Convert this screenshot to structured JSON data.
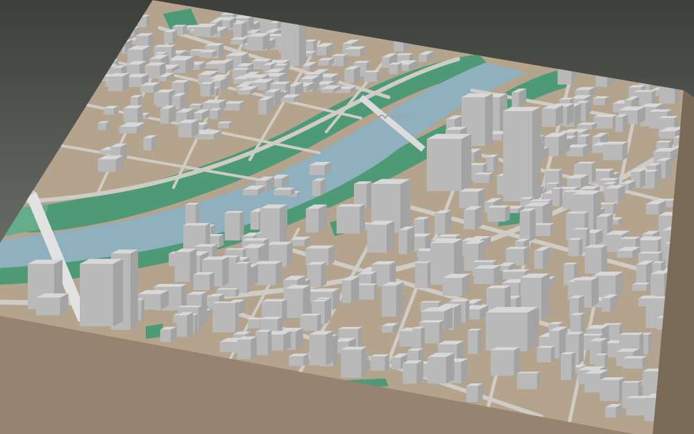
{
  "scene": {
    "kind": "3d-city-model-render",
    "colors": {
      "background_top": "#3d3f3b",
      "background_bottom": "#8a8c86",
      "ground": "#b4a48e",
      "base_side": "#968470",
      "base_side_dark": "#7a6a58",
      "road": "#cfccc6",
      "river": "#8fb0bf",
      "green": "#4f9a76",
      "green_light": "#64ad88",
      "building_top": "#d8d8d8",
      "building_left": "#b9b9b9",
      "building_right": "#a3a3a3",
      "bridge": "#dcdcdc"
    }
  }
}
